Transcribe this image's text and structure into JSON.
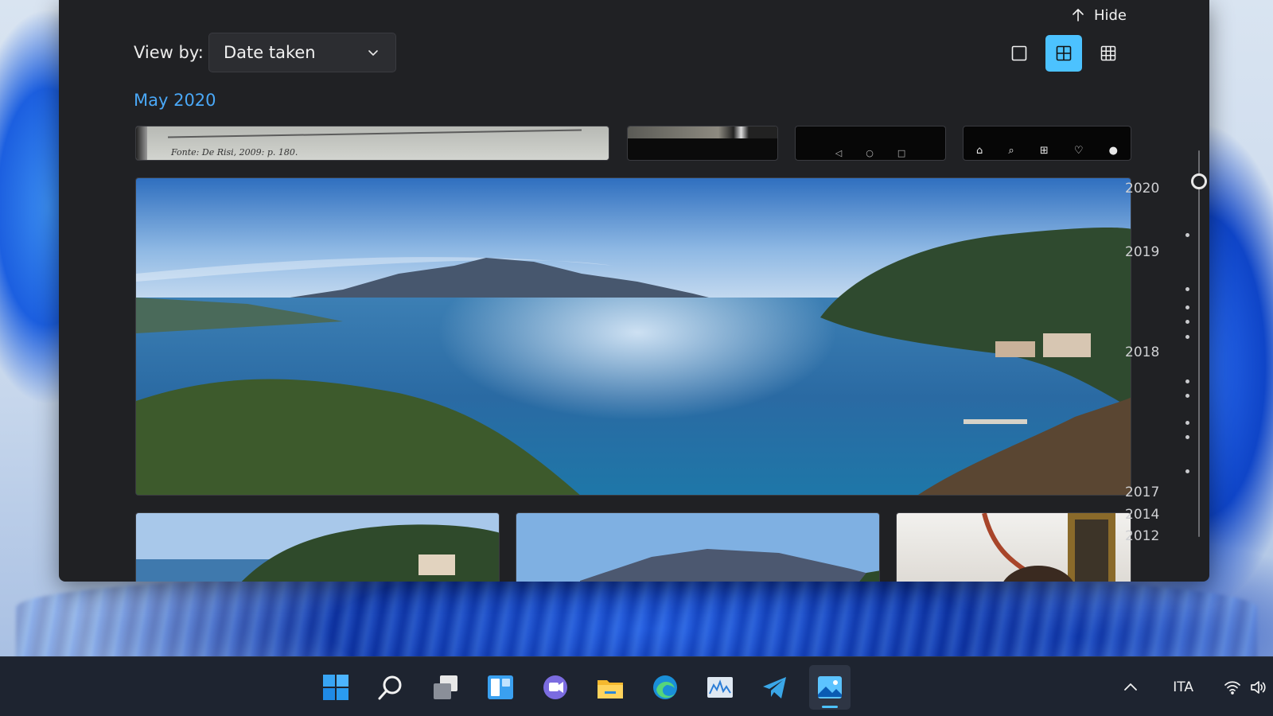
{
  "window": {
    "hide_label": "Hide",
    "view_by_label": "View by:",
    "view_by_value": "Date taken",
    "month_heading": "May 2020",
    "view_modes": [
      {
        "name": "single",
        "icon": "square-icon",
        "active": false
      },
      {
        "name": "medium",
        "icon": "grid-2x2-icon",
        "active": true
      },
      {
        "name": "small",
        "icon": "grid-3x3-icon",
        "active": false
      }
    ],
    "accent_color": "#4cc2ff",
    "link_color": "#4aa8f7"
  },
  "photos": {
    "doc_caption": "Fonte: De Risi, 2009: p. 180."
  },
  "timeline": {
    "years": [
      "2020",
      "2019",
      "2018",
      "2017",
      "2014",
      "2012"
    ]
  },
  "taskbar": {
    "apps": [
      {
        "name": "start",
        "icon": "windows-start-icon"
      },
      {
        "name": "search",
        "icon": "search-icon"
      },
      {
        "name": "task-view",
        "icon": "task-view-icon"
      },
      {
        "name": "widgets",
        "icon": "widgets-icon"
      },
      {
        "name": "chat",
        "icon": "teams-chat-icon"
      },
      {
        "name": "file-explorer",
        "icon": "folder-icon"
      },
      {
        "name": "edge",
        "icon": "edge-browser-icon"
      },
      {
        "name": "resource-monitor",
        "icon": "monitor-chart-icon"
      },
      {
        "name": "telegram",
        "icon": "telegram-icon"
      },
      {
        "name": "photos",
        "icon": "photos-app-icon",
        "active": true
      }
    ],
    "tray": {
      "language": "ITA"
    }
  }
}
